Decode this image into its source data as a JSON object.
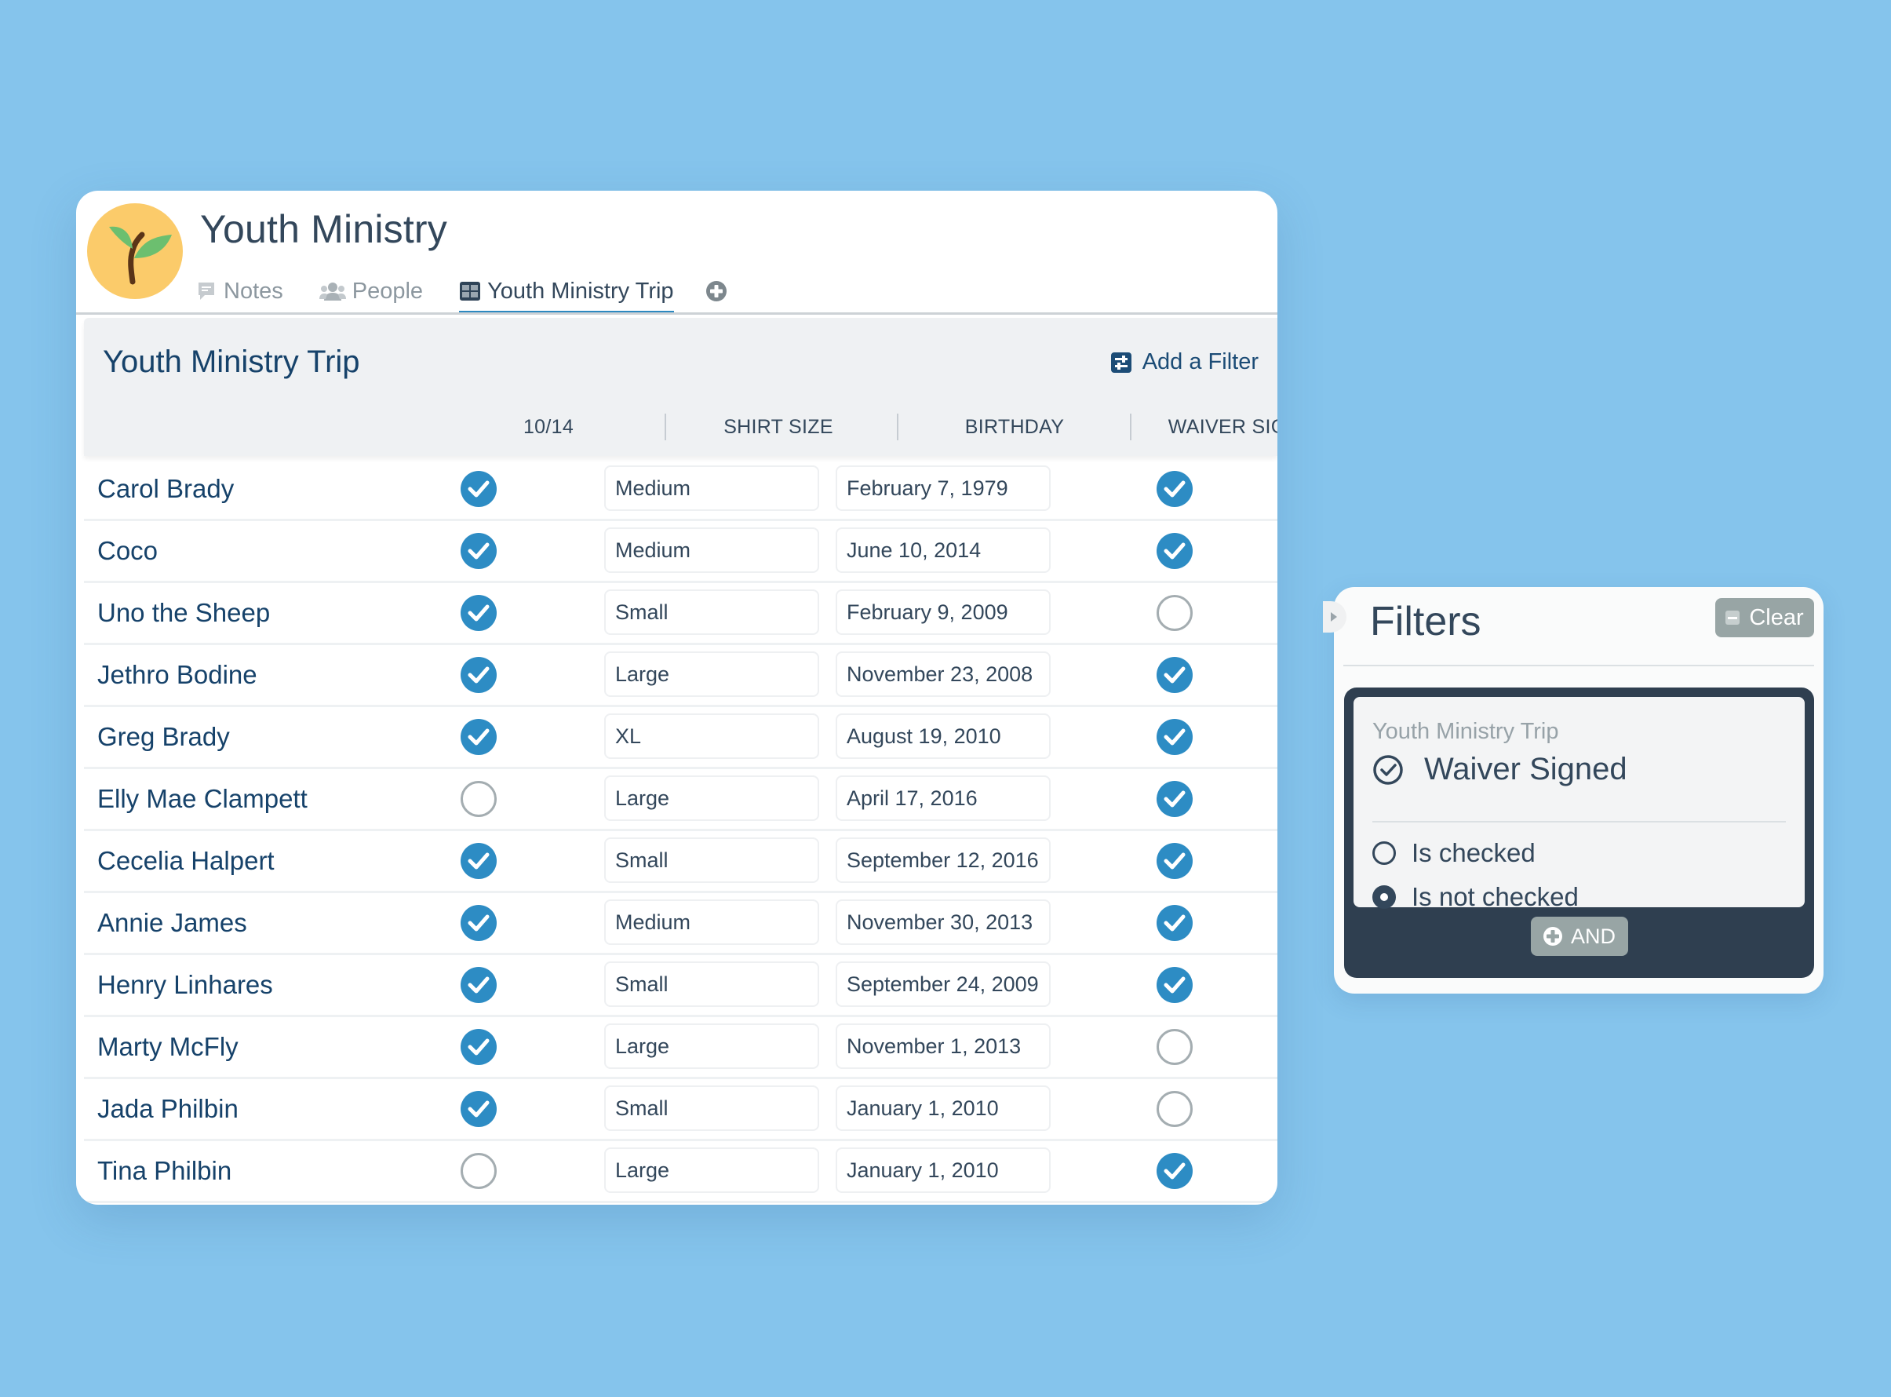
{
  "app": {
    "title": "Youth Ministry",
    "logo_icon": "sprout-icon",
    "colors": {
      "background": "#85c4ec",
      "accent": "#2d8cc4",
      "heading": "#16426a",
      "text": "#33475b",
      "logo_bg": "#fbcb6a",
      "leaf": "#6cbf6f",
      "filter_group_bg": "#2f3f50"
    }
  },
  "tabs": [
    {
      "label": "Notes",
      "icon": "note-icon",
      "active": false
    },
    {
      "label": "People",
      "icon": "people-icon",
      "active": false
    },
    {
      "label": "Youth Ministry Trip",
      "icon": "table-icon",
      "active": true
    }
  ],
  "tab_add_icon": "plus-circle-icon",
  "section": {
    "title": "Youth Ministry Trip",
    "add_filter_label": "Add a Filter",
    "add_filter_icon": "sliders-icon"
  },
  "table": {
    "columns": [
      "",
      "10/14",
      "SHIRT SIZE",
      "BIRTHDAY",
      "WAIVER SIGNED"
    ],
    "rows": [
      {
        "name": "Carol Brady",
        "attended": true,
        "shirt": "Medium",
        "birthday": "February 7, 1979",
        "waiver": true
      },
      {
        "name": "Coco",
        "attended": true,
        "shirt": "Medium",
        "birthday": "June 10, 2014",
        "waiver": true
      },
      {
        "name": "Uno the Sheep",
        "attended": true,
        "shirt": "Small",
        "birthday": "February 9, 2009",
        "waiver": false
      },
      {
        "name": "Jethro Bodine",
        "attended": true,
        "shirt": "Large",
        "birthday": "November 23, 2008",
        "waiver": true
      },
      {
        "name": "Greg Brady",
        "attended": true,
        "shirt": "XL",
        "birthday": "August 19, 2010",
        "waiver": true
      },
      {
        "name": "Elly Mae Clampett",
        "attended": false,
        "shirt": "Large",
        "birthday": "April 17, 2016",
        "waiver": true
      },
      {
        "name": "Cecelia Halpert",
        "attended": true,
        "shirt": "Small",
        "birthday": "September 12, 2016",
        "waiver": true
      },
      {
        "name": "Annie James",
        "attended": true,
        "shirt": "Medium",
        "birthday": "November 30, 2013",
        "waiver": true
      },
      {
        "name": "Henry Linhares",
        "attended": true,
        "shirt": "Small",
        "birthday": "September 24, 2009",
        "waiver": true
      },
      {
        "name": "Marty McFly",
        "attended": true,
        "shirt": "Large",
        "birthday": "November 1, 2013",
        "waiver": false
      },
      {
        "name": "Jada Philbin",
        "attended": true,
        "shirt": "Small",
        "birthday": "January 1, 2010",
        "waiver": false
      },
      {
        "name": "Tina Philbin",
        "attended": false,
        "shirt": "Large",
        "birthday": "January 1, 2010",
        "waiver": true
      }
    ]
  },
  "filters": {
    "title": "Filters",
    "clear_label": "Clear",
    "group": {
      "source": "Youth Ministry Trip",
      "field": "Waiver Signed",
      "field_icon": "check-circle-icon",
      "options": [
        {
          "label": "Is checked",
          "selected": false
        },
        {
          "label": "Is not checked",
          "selected": true
        }
      ]
    },
    "and_label": "AND"
  }
}
